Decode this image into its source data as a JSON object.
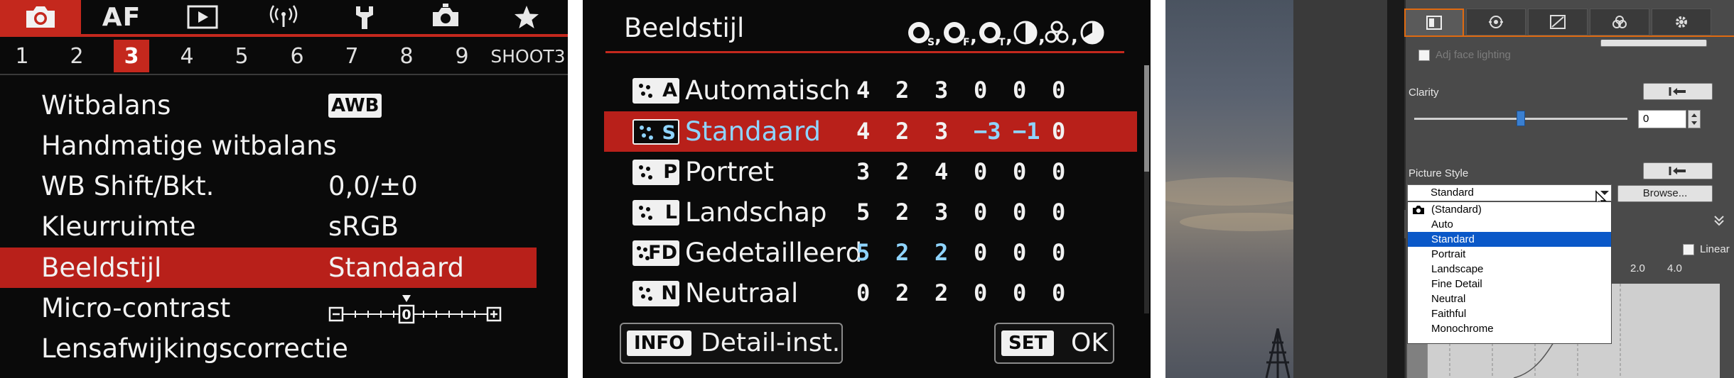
{
  "panel1": {
    "tabs": [
      {
        "icon": "camera-icon",
        "label": ""
      },
      {
        "icon": "autofocus-label",
        "label": "AF"
      },
      {
        "icon": "playback-icon",
        "label": ""
      },
      {
        "icon": "wireless-icon",
        "label": ""
      },
      {
        "icon": "wrench-icon",
        "label": ""
      },
      {
        "icon": "custom-camera-icon",
        "label": ""
      },
      {
        "icon": "star-icon",
        "label": ""
      }
    ],
    "active_tab": 0,
    "pages": [
      "1",
      "2",
      "3",
      "4",
      "5",
      "6",
      "7",
      "8",
      "9"
    ],
    "active_page": "3",
    "page_name": "SHOOT3",
    "items": [
      {
        "label": "Witbalans",
        "value": "AWB"
      },
      {
        "label": "Handmatige witbalans",
        "value": ""
      },
      {
        "label": "WB Shift/Bkt.",
        "value": "0,0/±0"
      },
      {
        "label": "Kleurruimte",
        "value": "sRGB"
      },
      {
        "label": "Beeldstijl",
        "value": "Standaard"
      },
      {
        "label": "Micro-contrast",
        "value": "0"
      },
      {
        "label": "Lensafwijkingscorrectie",
        "value": ""
      }
    ],
    "selected_item": 4,
    "colors": {
      "accent": "#c4281d",
      "background": "#0a0a0a"
    }
  },
  "panel2": {
    "title": "Beeldstijl",
    "header_icons": [
      "sharpness-S-icon",
      "sharpness-F-icon",
      "sharpness-T-icon",
      "contrast-icon",
      "saturation-icon",
      "color-tone-icon"
    ],
    "styles": [
      {
        "code": "A",
        "name": "Automatisch",
        "values": [
          "4",
          "2",
          "3",
          "0",
          "0",
          "0"
        ],
        "highlight": []
      },
      {
        "code": "S",
        "name": "Standaard",
        "values": [
          "4",
          "2",
          "3",
          "−3",
          "−1",
          "0"
        ],
        "highlight": [
          3,
          4
        ]
      },
      {
        "code": "P",
        "name": "Portret",
        "values": [
          "3",
          "2",
          "4",
          "0",
          "0",
          "0"
        ],
        "highlight": []
      },
      {
        "code": "L",
        "name": "Landschap",
        "values": [
          "5",
          "2",
          "3",
          "0",
          "0",
          "0"
        ],
        "highlight": []
      },
      {
        "code": "FD",
        "name": "Gedetailleerd",
        "values": [
          "5",
          "2",
          "2",
          "0",
          "0",
          "0"
        ],
        "highlight": [
          0,
          1,
          2
        ]
      },
      {
        "code": "N",
        "name": "Neutraal",
        "values": [
          "0",
          "2",
          "2",
          "0",
          "0",
          "0"
        ],
        "highlight": []
      }
    ],
    "selected_style": 1,
    "info_key": "INFO",
    "info_label": "Detail-inst.",
    "set_key": "SET",
    "set_label": "OK",
    "colors": {
      "accent": "#c4281d",
      "modified": "#8fd4ff"
    }
  },
  "panel3": {
    "tabs": [
      "basic-adjust-icon",
      "lens-icon",
      "curve-icon",
      "color-icon",
      "settings-gear-icon"
    ],
    "active_tab": 0,
    "adj_face_lighting": "Adj face lighting",
    "clarity_label": "Clarity",
    "clarity_value": "0",
    "clarity_level": 0.48,
    "picture_style_label": "Picture Style",
    "picture_style_value": "Standard",
    "browse_label": "Browse...",
    "linear_label": "Linear",
    "scale_labels": [
      "2.0",
      "4.0"
    ],
    "dropdown": [
      "(Standard)",
      "Auto",
      "Standard",
      "Portrait",
      "Landscape",
      "Fine Detail",
      "Neutral",
      "Faithful",
      "Monochrome"
    ],
    "dropdown_selected": 2,
    "colors": {
      "tab_accent": "#e06a10",
      "selection": "#0a58c8"
    }
  }
}
